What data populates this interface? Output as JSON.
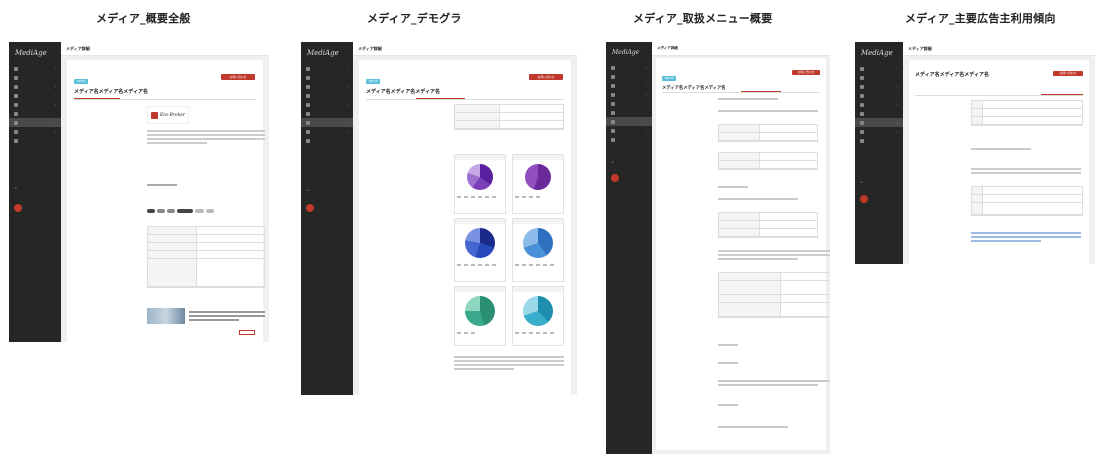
{
  "headings": [
    "メディア_概要全般",
    "メディア_デモグラ",
    "メディア_取扱メニュー概要",
    "メディア_主要広告主利用傾向"
  ],
  "app": {
    "logo": "MediAge",
    "page_title": "メディア詳細",
    "badge": "BADGE",
    "media_title": "メディア名メディア名メディア名",
    "red_button": "お問い合わせ"
  },
  "colors": {
    "sidebar_bg": "#262626",
    "accent_red": "#c0392b",
    "badge_blue": "#5bc0de",
    "pie_purple": "#7b3fb8",
    "pie_blue": "#2748b8",
    "pie_lightblue": "#4a90d9",
    "pie_green": "#3aa88a",
    "pie_teal": "#3aaccc"
  },
  "logo_caption": "Era-Broker",
  "icons": [
    "chevron-right-icon",
    "logout-icon",
    "avatar-icon",
    "external-link-icon"
  ]
}
